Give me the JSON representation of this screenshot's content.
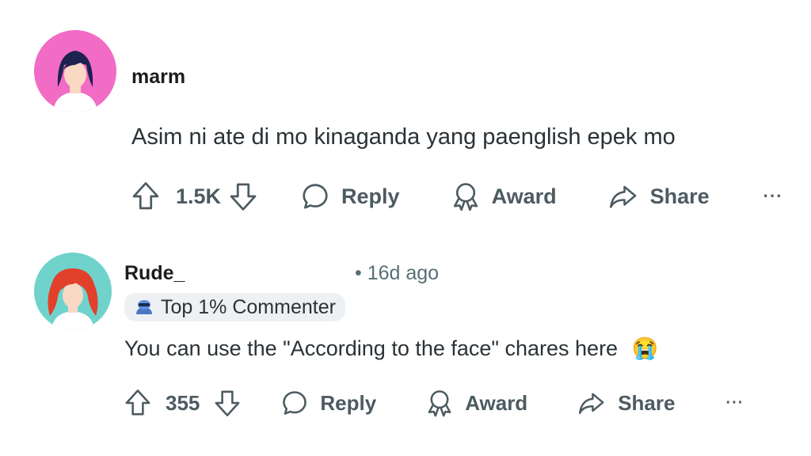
{
  "comments": [
    {
      "username": "marm",
      "body": "Asim ni ate di mo kinaganda yang paenglish epek mo",
      "votes": "1.5K",
      "reply_label": "Reply",
      "award_label": "Award",
      "share_label": "Share",
      "more_label": "···",
      "avatar_bg": "#f26bc4"
    },
    {
      "username": "Rude_",
      "timestamp": "• 16d ago",
      "badge": "Top 1% Commenter",
      "body": "You can use the \"According to the face\" chares here",
      "emoji": "😭",
      "votes": "355",
      "reply_label": "Reply",
      "award_label": "Award",
      "share_label": "Share",
      "more_label": "···",
      "avatar_bg": "#6fd3cc"
    }
  ]
}
